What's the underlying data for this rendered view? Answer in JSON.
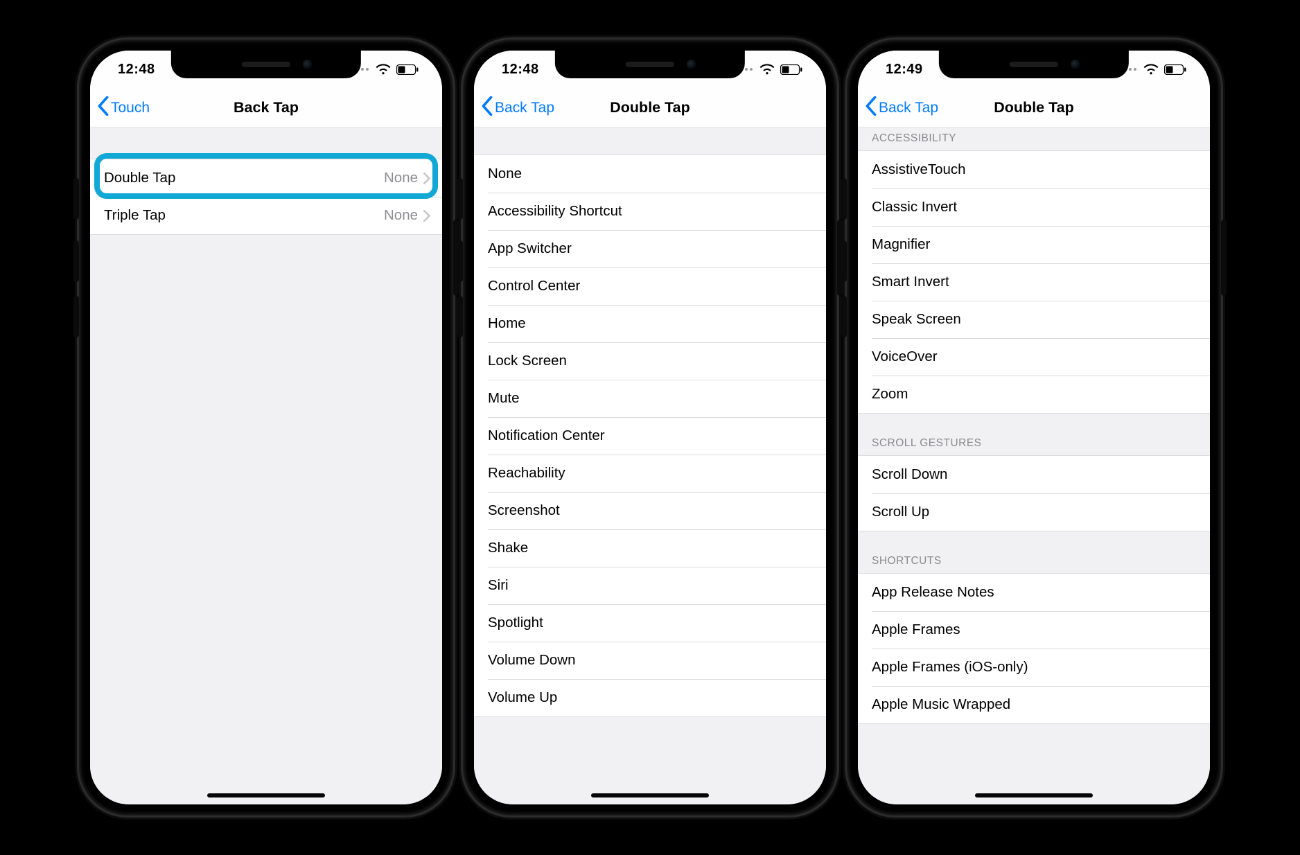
{
  "phones": [
    {
      "time": "12:48",
      "nav": {
        "back": "Touch",
        "title": "Back Tap"
      },
      "rows": [
        {
          "label": "Double Tap",
          "value": "None",
          "highlighted": true
        },
        {
          "label": "Triple Tap",
          "value": "None",
          "highlighted": false
        }
      ]
    },
    {
      "time": "12:48",
      "nav": {
        "back": "Back Tap",
        "title": "Double Tap"
      },
      "options": [
        "None",
        "Accessibility Shortcut",
        "App Switcher",
        "Control Center",
        "Home",
        "Lock Screen",
        "Mute",
        "Notification Center",
        "Reachability",
        "Screenshot",
        "Shake",
        "Siri",
        "Spotlight",
        "Volume Down",
        "Volume Up"
      ]
    },
    {
      "time": "12:49",
      "nav": {
        "back": "Back Tap",
        "title": "Double Tap"
      },
      "sections": [
        {
          "header": "Accessibility",
          "items": [
            "AssistiveTouch",
            "Classic Invert",
            "Magnifier",
            "Smart Invert",
            "Speak Screen",
            "VoiceOver",
            "Zoom"
          ]
        },
        {
          "header": "Scroll Gestures",
          "items": [
            "Scroll Down",
            "Scroll Up"
          ]
        },
        {
          "header": "Shortcuts",
          "items": [
            "App Release Notes",
            "Apple Frames",
            "Apple Frames (iOS-only)",
            "Apple Music Wrapped"
          ]
        }
      ]
    }
  ]
}
